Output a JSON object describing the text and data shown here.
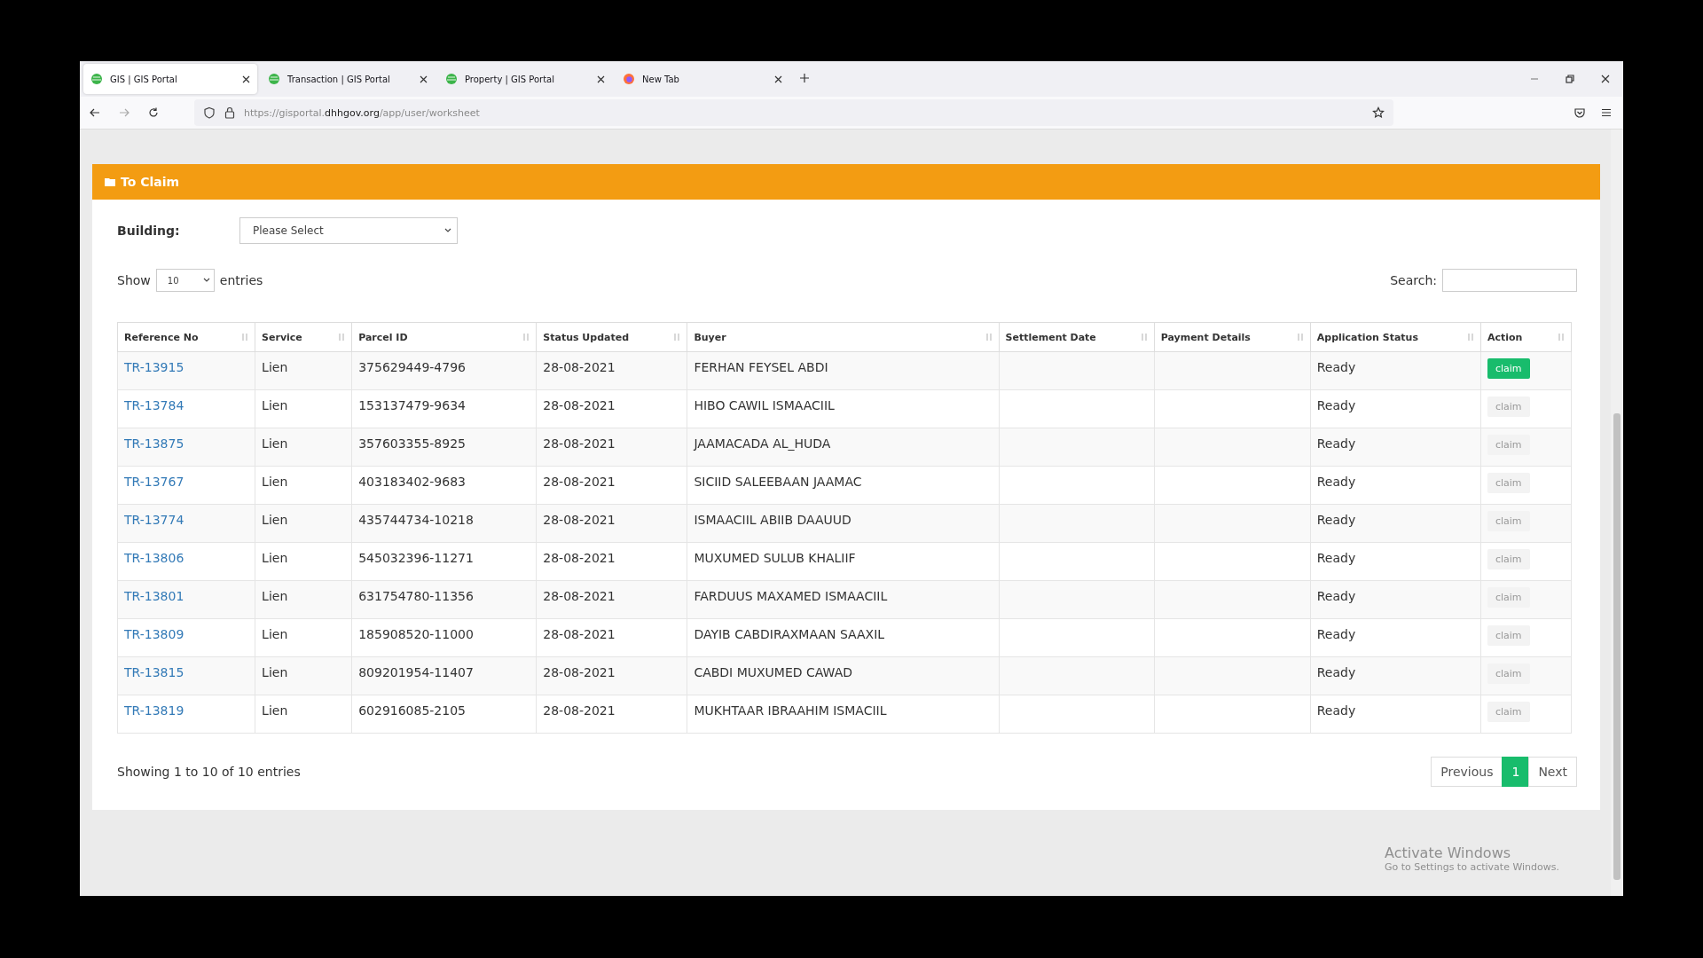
{
  "browser": {
    "tabs": [
      {
        "title": "GIS | GIS Portal",
        "kind": "site",
        "selected": true
      },
      {
        "title": "Transaction | GIS Portal",
        "kind": "site",
        "selected": false
      },
      {
        "title": "Property | GIS Portal",
        "kind": "site",
        "selected": false
      },
      {
        "title": "New Tab",
        "kind": "browser",
        "selected": false
      }
    ],
    "url": {
      "start": "https://gisportal.",
      "domain": "dhhgov.org",
      "path": "/app/user/worksheet"
    }
  },
  "panel": {
    "title": "To Claim",
    "building_label": "Building:",
    "building_value": "Please Select",
    "show_label": "Show",
    "page_size": "10",
    "entries_label": "entries",
    "search_label": "Search:",
    "table": {
      "columns": [
        "Reference No",
        "Service",
        "Parcel ID",
        "Status Updated",
        "Buyer",
        "Settlement Date",
        "Payment Details",
        "Application Status",
        "Action"
      ],
      "rows": [
        {
          "ref": "TR-13915",
          "service": "Lien",
          "parcel": "375629449-4796",
          "updated": "28-08-2021",
          "buyer": "FERHAN FEYSEL ABDI",
          "status": "Ready",
          "action": "claim",
          "disabled": false
        },
        {
          "ref": "TR-13784",
          "service": "Lien",
          "parcel": "153137479-9634",
          "updated": "28-08-2021",
          "buyer": "HIBO CAWIL ISMAACIIL",
          "status": "Ready",
          "action": "claim",
          "disabled": true
        },
        {
          "ref": "TR-13875",
          "service": "Lien",
          "parcel": "357603355-8925",
          "updated": "28-08-2021",
          "buyer": "JAAMACADA AL_HUDA",
          "status": "Ready",
          "action": "claim",
          "disabled": true
        },
        {
          "ref": "TR-13767",
          "service": "Lien",
          "parcel": "403183402-9683",
          "updated": "28-08-2021",
          "buyer": "SICIID SALEEBAAN JAAMAC",
          "status": "Ready",
          "action": "claim",
          "disabled": true
        },
        {
          "ref": "TR-13774",
          "service": "Lien",
          "parcel": "435744734-10218",
          "updated": "28-08-2021",
          "buyer": "ISMAACIIL ABIIB DAAUUD",
          "status": "Ready",
          "action": "claim",
          "disabled": true
        },
        {
          "ref": "TR-13806",
          "service": "Lien",
          "parcel": "545032396-11271",
          "updated": "28-08-2021",
          "buyer": "MUXUMED SULUB KHALIIF",
          "status": "Ready",
          "action": "claim",
          "disabled": true
        },
        {
          "ref": "TR-13801",
          "service": "Lien",
          "parcel": "631754780-11356",
          "updated": "28-08-2021",
          "buyer": "FARDUUS MAXAMED ISMAACIIL",
          "status": "Ready",
          "action": "claim",
          "disabled": true
        },
        {
          "ref": "TR-13809",
          "service": "Lien",
          "parcel": "185908520-11000",
          "updated": "28-08-2021",
          "buyer": "DAYIB CABDIRAXMAAN SAAXIL",
          "status": "Ready",
          "action": "claim",
          "disabled": true
        },
        {
          "ref": "TR-13815",
          "service": "Lien",
          "parcel": "809201954-11407",
          "updated": "28-08-2021",
          "buyer": "CABDI MUXUMED CAWAD",
          "status": "Ready",
          "action": "claim",
          "disabled": true
        },
        {
          "ref": "TR-13819",
          "service": "Lien",
          "parcel": "602916085-2105",
          "updated": "28-08-2021",
          "buyer": "MUKHTAAR IBRAAHIM ISMACIIL",
          "status": "Ready",
          "action": "claim",
          "disabled": true
        }
      ]
    },
    "info": "Showing 1 to 10 of 10 entries",
    "pagination": [
      {
        "label": "Previous",
        "selected": false
      },
      {
        "label": "1",
        "selected": true
      },
      {
        "label": "Next",
        "selected": false
      }
    ]
  },
  "activation_notice": {
    "title": "Activate Windows",
    "subtitle": "Go to Settings to activate Windows."
  }
}
